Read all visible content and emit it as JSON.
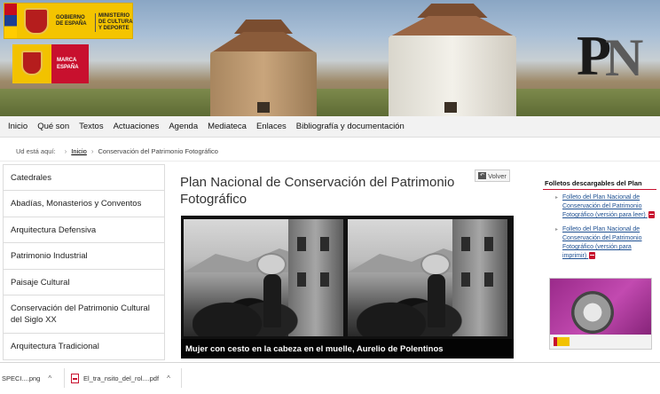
{
  "header": {
    "gov_logo_text_1": "GOBIERNO DE ESPAÑA",
    "gov_logo_text_2": "MINISTERIO DE CULTURA Y DEPORTE",
    "marca_logo_text": "MARCA ESPAÑA",
    "pn_logo_p": "P",
    "pn_logo_n": "N"
  },
  "nav": {
    "items": [
      "Inicio",
      "Qué son",
      "Textos",
      "Actuaciones",
      "Agenda",
      "Mediateca",
      "Enlaces",
      "Bibliografía y documentación"
    ]
  },
  "breadcrumb": {
    "label": "Ud está aquí:",
    "home": "Inicio",
    "current": "Conservación del Patrimonio Fotográfico"
  },
  "sidebar": {
    "items": [
      "Catedrales",
      "Abadías, Monasterios y Conventos",
      "Arquitectura Defensiva",
      "Patrimonio Industrial",
      "Paisaje Cultural",
      "Conservación del Patrimonio Cultural del Siglo XX",
      "Arquitectura Tradicional"
    ]
  },
  "main": {
    "title": "Plan Nacional de Conservación del Patrimonio Fotográfico",
    "back_label": "Volver",
    "photo_caption": "Mujer con cesto en la cabeza en el muelle, Aurelio de Polentinos"
  },
  "rightcol": {
    "title": "Folletos descargables del Plan",
    "items": [
      "Folleto del Plan Nacional de Conservación del Patrimonio Fotográfico (versión para leer)",
      "Folleto del Plan Nacional de Conservación del Patrimonio Fotográfico (versión para imprimir)"
    ]
  },
  "downloads": {
    "items": [
      "SPECI....png",
      "El_tra_nsito_del_rol....pdf"
    ]
  },
  "colors": {
    "accent_red": "#c8102e",
    "link_blue": "#1d4f91",
    "gov_yellow": "#f4c400"
  }
}
